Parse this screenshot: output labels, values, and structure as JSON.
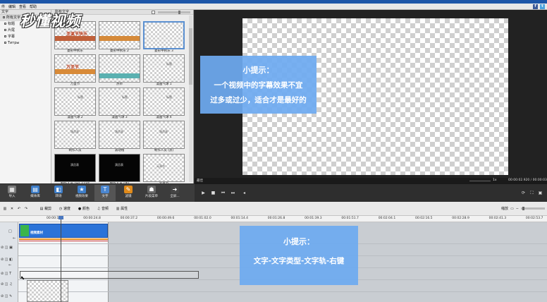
{
  "menu": [
    "件",
    "编辑",
    "查看",
    "帮助"
  ],
  "social": [
    {
      "letter": "f",
      "color": "#3b5998"
    },
    {
      "letter": "t",
      "color": "#4aa3df"
    }
  ],
  "logo_text": "秒懂视频",
  "tree": {
    "header": "文字",
    "items": [
      {
        "label": "所有文字",
        "selected": true
      },
      {
        "label": "标题",
        "selected": false
      },
      {
        "label": "片尾",
        "selected": false
      },
      {
        "label": "字幕",
        "selected": false
      },
      {
        "label": "Титры",
        "selected": false
      }
    ]
  },
  "gallery": {
    "header": "所有文字",
    "thumbs": [
      {
        "caption": "菱形中秋乐",
        "style": "banner-red",
        "text": "圣诞节快乐"
      },
      {
        "caption": "菱形中秋乐 2",
        "style": "banner-orange",
        "text": ""
      },
      {
        "caption": "菱形中秋乐 3",
        "style": "selected",
        "text": ""
      },
      {
        "caption": "万圣节",
        "style": "banner-orange2",
        "text": "万圣节"
      },
      {
        "caption": "热带",
        "style": "banner-teal",
        "text": ""
      },
      {
        "caption": "漫画气球 1",
        "style": "bubble",
        "text": "标题"
      },
      {
        "caption": "漫画气球 2",
        "style": "bubble",
        "text": "标题"
      },
      {
        "caption": "漫画气球 3",
        "style": "bubble",
        "text": "标题"
      },
      {
        "caption": "漫画气球 4",
        "style": "bubble",
        "text": "标题"
      },
      {
        "caption": "制作人员",
        "style": "credits",
        "text": "演员表"
      },
      {
        "caption": "滚动线",
        "style": "credits",
        "text": "演员表"
      },
      {
        "caption": "制作人员 (黑)",
        "style": "credits",
        "text": "演员表"
      },
      {
        "caption": "制作人员 (白) 2 Oct",
        "style": "black",
        "text": "演员表"
      },
      {
        "caption": "制作人员 (黑)",
        "style": "black",
        "text": "演员表"
      },
      {
        "caption": "元宵节",
        "style": "plain",
        "text": "元宵节"
      }
    ]
  },
  "preview": {
    "status_left": "最佳",
    "speed": "1x",
    "time": "00:00:02.920 / 00:00:03"
  },
  "tools": [
    {
      "label": "导入",
      "icon": "▦",
      "color": "#7a7a7a"
    },
    {
      "label": "媒体库",
      "icon": "▤",
      "color": "#3d7dc8"
    },
    {
      "label": "转场",
      "icon": "◧",
      "color": "#3d7dc8"
    },
    {
      "label": "视频效果",
      "icon": "★",
      "color": "#3d7dc8"
    },
    {
      "label": "文字",
      "icon": "T",
      "color": "#4a86d0"
    },
    {
      "label": "滤镜",
      "icon": "✎",
      "color": "#e08a1a"
    },
    {
      "label": "片段菜单",
      "icon": "☗",
      "color": "#666"
    },
    {
      "label": "全屏...",
      "icon": "➜",
      "color": "#444"
    }
  ],
  "timeline_toolbar": {
    "items": [
      {
        "label": "裁剪",
        "icon": "▤"
      },
      {
        "label": "速度",
        "icon": "◷"
      },
      {
        "label": "颜色",
        "icon": "●"
      },
      {
        "label": "音频",
        "icon": "♫"
      },
      {
        "label": "属性",
        "icon": "▥"
      }
    ],
    "zoom_label": "缩放"
  },
  "ruler": [
    "00:00:12.4",
    "00:00:24.8",
    "00:00:37.2",
    "00:00:49.6",
    "00:01:02.0",
    "00:01:14.4",
    "00:01:26.8",
    "00:01:39.3",
    "00:01:51.7",
    "00:02:04.1",
    "00:02:16.5",
    "00:02:28.9",
    "00:02:41.3",
    "00:02:53.7"
  ],
  "clip": {
    "label": "视频素材"
  },
  "tip_top": {
    "title": "小提示：",
    "lines": [
      "一个视频中的字幕效果不宜",
      "过多或过少，适合才是最好的"
    ]
  },
  "tip_bottom": {
    "title": "小提示：",
    "lines": [
      "文字-文字类型-文字轨-右键"
    ]
  }
}
